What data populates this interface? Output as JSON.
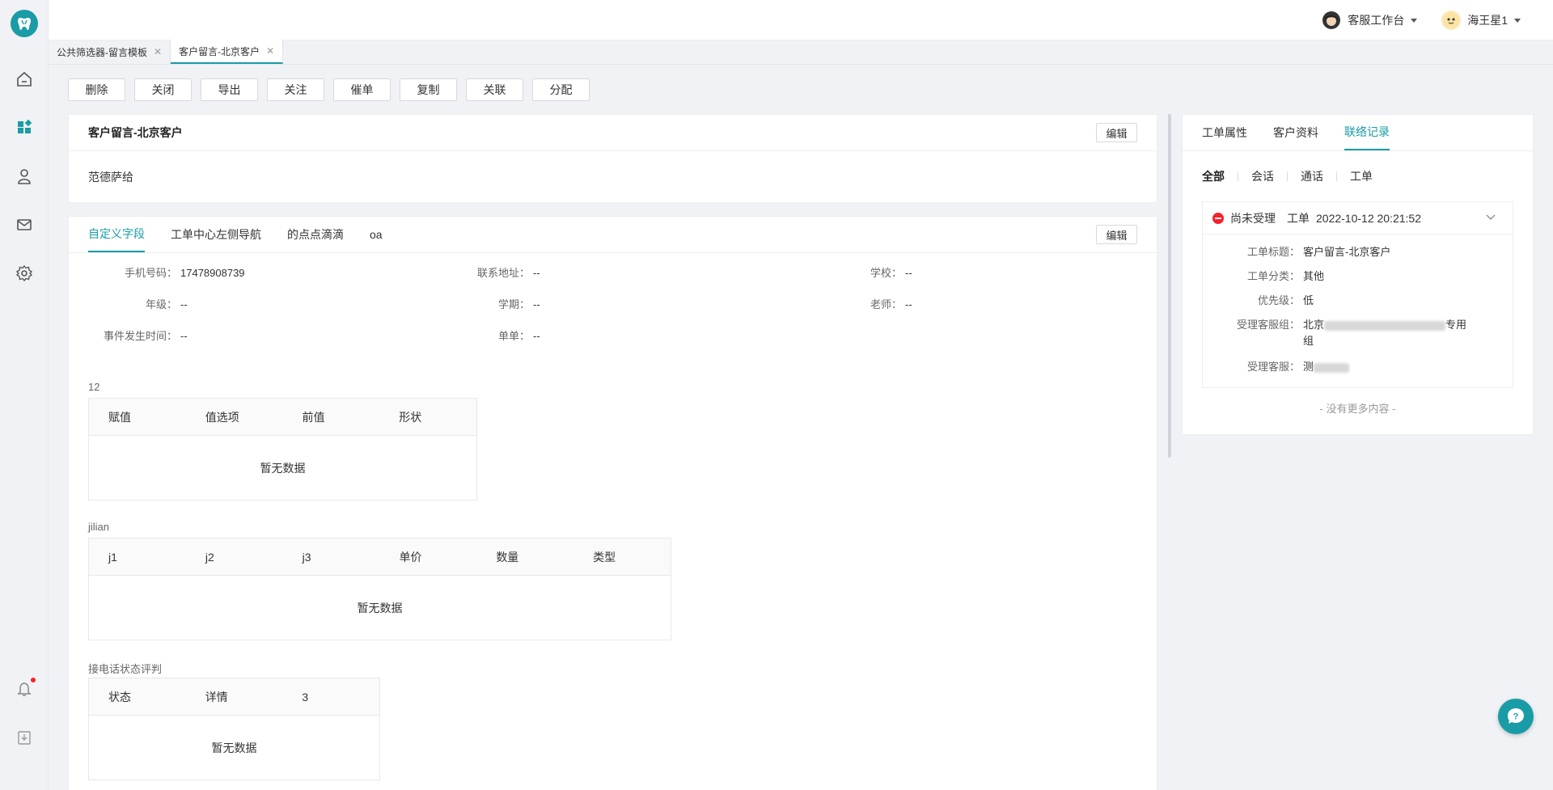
{
  "header": {
    "workspace_label": "客服工作台",
    "user_name": "海王星1"
  },
  "page_tabs": [
    {
      "label": "公共筛选器-留言模板"
    },
    {
      "label": "客户留言-北京客户"
    }
  ],
  "actions": [
    "删除",
    "关闭",
    "导出",
    "关注",
    "催单",
    "复制",
    "关联",
    "分配"
  ],
  "ticket": {
    "title": "客户留言-北京客户",
    "edit_label": "编辑",
    "body": "范德萨给"
  },
  "fields_panel": {
    "tabs": [
      "自定义字段",
      "工单中心左侧导航",
      "的点点滴滴",
      "oa"
    ],
    "edit_label": "编辑",
    "fields": [
      {
        "label": "手机号码：",
        "value": "17478908739"
      },
      {
        "label": "联系地址：",
        "value": "--"
      },
      {
        "label": "学校：",
        "value": "--"
      },
      {
        "label": "年级：",
        "value": "--"
      },
      {
        "label": "学期：",
        "value": "--"
      },
      {
        "label": "老师：",
        "value": "--"
      },
      {
        "label": "事件发生时间：",
        "value": "--"
      },
      {
        "label": "单单：",
        "value": "--"
      }
    ],
    "tables": [
      {
        "title": "12",
        "columns": [
          "赋值",
          "值选项",
          "前值",
          "形状"
        ],
        "empty": "暂无数据"
      },
      {
        "title": "jilian",
        "columns": [
          "j1",
          "j2",
          "j3",
          "单价",
          "数量",
          "类型"
        ],
        "empty": "暂无数据"
      },
      {
        "title": "接电话状态评判",
        "columns": [
          "状态",
          "详情",
          "3"
        ],
        "empty": "暂无数据"
      }
    ]
  },
  "right_panel": {
    "tabs": [
      "工单属性",
      "客户资料",
      "联络记录"
    ],
    "filters": [
      "全部",
      "会话",
      "通话",
      "工单"
    ],
    "record": {
      "status": "尚未受理",
      "type": "工单",
      "time": "2022-10-12 20:21:52",
      "rows": [
        {
          "label": "工单标题：",
          "value": "客户留言-北京客户"
        },
        {
          "label": "工单分类：",
          "value": "其他"
        },
        {
          "label": "优先级：",
          "value": "低"
        },
        {
          "label": "受理客服组：",
          "value_start": "北京",
          "value_end": "专用",
          "value_line2": "组"
        },
        {
          "label": "受理客服：",
          "value_start": "测"
        }
      ]
    },
    "no_more": "- 没有更多内容 -"
  },
  "colors": {
    "accent": "#1a9ca6",
    "status_red": "#f5222d"
  }
}
